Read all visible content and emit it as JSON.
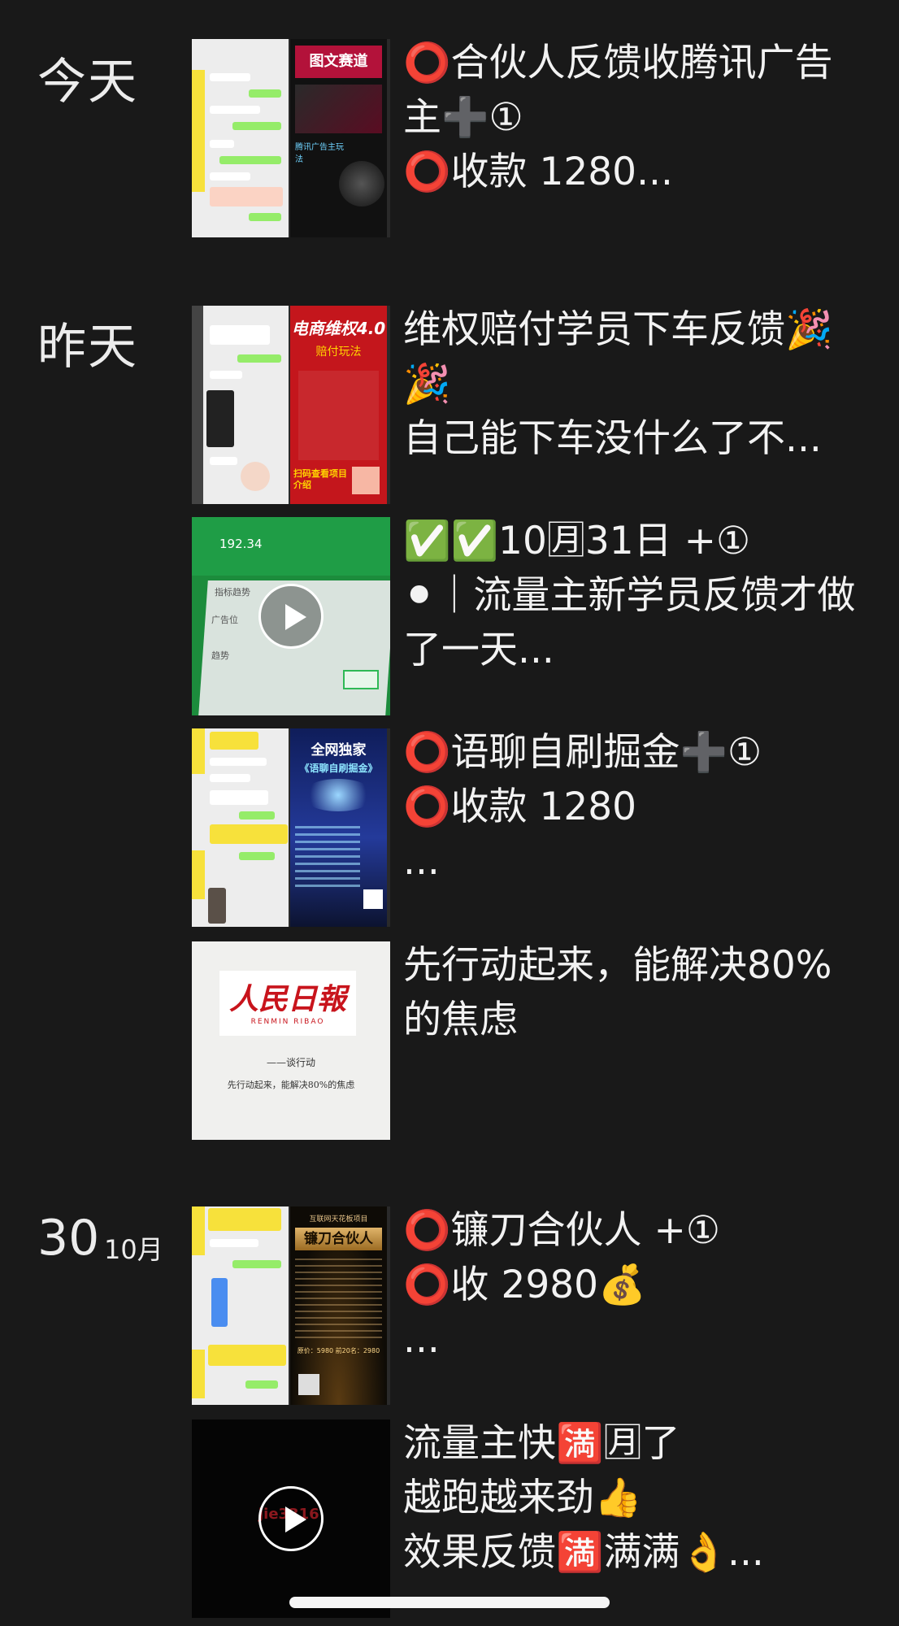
{
  "sections": [
    {
      "date": "今天"
    },
    {
      "date": "昨天"
    },
    {
      "day": "30",
      "month": "10月"
    }
  ],
  "posts": [
    {
      "text": "⭕合伙人反馈收腾讯广告主➕①\n⭕收款 1280...",
      "thumb_title": "图文赛道",
      "thumb_sub": "腾讯广告主玩法"
    },
    {
      "text": "维权赔付学员下车反馈🎉🎉\n自己能下车没什么了不...",
      "thumb_title": "电商维权4.0",
      "thumb_sub": "赔付玩法",
      "thumb_foot": "扫码查看项目介绍"
    },
    {
      "text": "✅✅10🈷31日 +①\n⚫｜流量主新学员反馈才做了一天...",
      "thumb_amount": "192.34",
      "thumb_tab1": "指标趋势",
      "thumb_tab2": "广告位",
      "thumb_tab3": "趋势"
    },
    {
      "text": "⭕语聊自刷掘金➕①\n⭕收款 1280\n...",
      "thumb_title": "全网独家",
      "thumb_sub": "《语聊自刷掘金》"
    },
    {
      "text": "先行动起来，能解决80%的焦虑",
      "thumb_logo": "人民日報",
      "thumb_logo_sub": "RENMIN RIBAO",
      "thumb_line1": "——谈行动",
      "thumb_line2": "先行动起来，能解决80%的焦虑"
    },
    {
      "text": "⭕镰刀合伙人 +①\n⭕收 2980💰\n...",
      "thumb_title": "镰刀合伙人",
      "thumb_top": "互联网天花板项目",
      "thumb_price": "原价：5980 前20名：2980"
    },
    {
      "text": "流量主快🈵🈷了\n越跑越来劲👍\n效果反馈🈵满满👌...",
      "thumb_watermark": "jie3316"
    }
  ],
  "colors": {
    "background": "#191919",
    "text": "#f2f2f2",
    "accent_red": "#e5222a"
  }
}
